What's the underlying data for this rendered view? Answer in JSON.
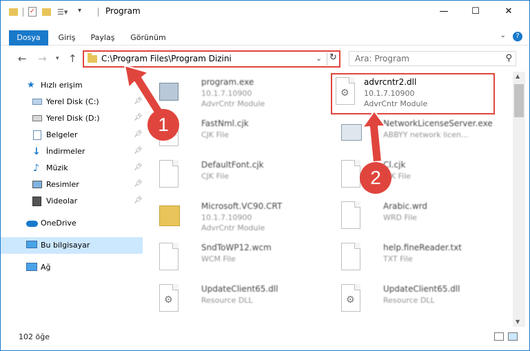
{
  "window": {
    "title": "Program",
    "controls": {
      "minimize": "—",
      "maximize": "☐",
      "close": "✕"
    }
  },
  "ribbon": {
    "tabs": [
      "Dosya",
      "Giriş",
      "Paylaş",
      "Görünüm"
    ]
  },
  "nav": {
    "address": "C:\\Program Files\\Program Dizini",
    "search_placeholder": "Ara: Program"
  },
  "sidebar": {
    "items": [
      {
        "label": "Hızlı erişim",
        "icon": "star-icon",
        "pinned": false
      },
      {
        "label": "Yerel Disk (C:)",
        "icon": "drive-icon",
        "pinned": true
      },
      {
        "label": "Yerel Disk (D:)",
        "icon": "drive-icon",
        "pinned": true
      },
      {
        "label": "Belgeler",
        "icon": "documents-icon",
        "pinned": true
      },
      {
        "label": "İndirmeler",
        "icon": "download-icon",
        "pinned": true
      },
      {
        "label": "Müzik",
        "icon": "music-icon",
        "pinned": true
      },
      {
        "label": "Resimler",
        "icon": "pictures-icon",
        "pinned": true
      },
      {
        "label": "Videolar",
        "icon": "videos-icon",
        "pinned": true
      },
      {
        "label": "OneDrive",
        "icon": "cloud-icon",
        "pinned": false
      },
      {
        "label": "Bu bilgisayar",
        "icon": "computer-icon",
        "pinned": false
      },
      {
        "label": "Ağ",
        "icon": "network-icon",
        "pinned": false
      }
    ]
  },
  "files": [
    {
      "name": "program.exe",
      "line1": "10.1.7.10900",
      "line2": "AdvrCntr Module"
    },
    {
      "name": "advrcntr2.dll",
      "line1": "10.1.7.10900",
      "line2": "AdvrCntr Module"
    },
    {
      "name": "FastNml.cjk",
      "line1": "CJK File",
      "line2": ""
    },
    {
      "name": "NetworkLicenseServer.exe",
      "line1": "ABBYY network licen...",
      "line2": ""
    },
    {
      "name": "DefaultFont.cjk",
      "line1": "CJK File",
      "line2": ""
    },
    {
      "name": "Cl.cjk",
      "line1": "CJK File",
      "line2": ""
    },
    {
      "name": "Microsoft.VC90.CRT",
      "line1": "10.1.7.10900",
      "line2": "AdvrCntr Module"
    },
    {
      "name": "Arabic.wrd",
      "line1": "WRD File",
      "line2": ""
    },
    {
      "name": "SndToWP12.wcm",
      "line1": "WCM File",
      "line2": ""
    },
    {
      "name": "help.fineReader.txt",
      "line1": "TXT File",
      "line2": ""
    },
    {
      "name": "UpdateClient65.dll",
      "line1": "Resource DLL",
      "line2": ""
    },
    {
      "name": "UpdateClient65.dll",
      "line1": "Resource DLL",
      "line2": ""
    }
  ],
  "status": {
    "count": "102 öğe"
  },
  "callouts": {
    "one": "1",
    "two": "2"
  },
  "colors": {
    "accent": "#1979ca",
    "highlight": "#e0453d",
    "selected": "#cce8ff"
  }
}
